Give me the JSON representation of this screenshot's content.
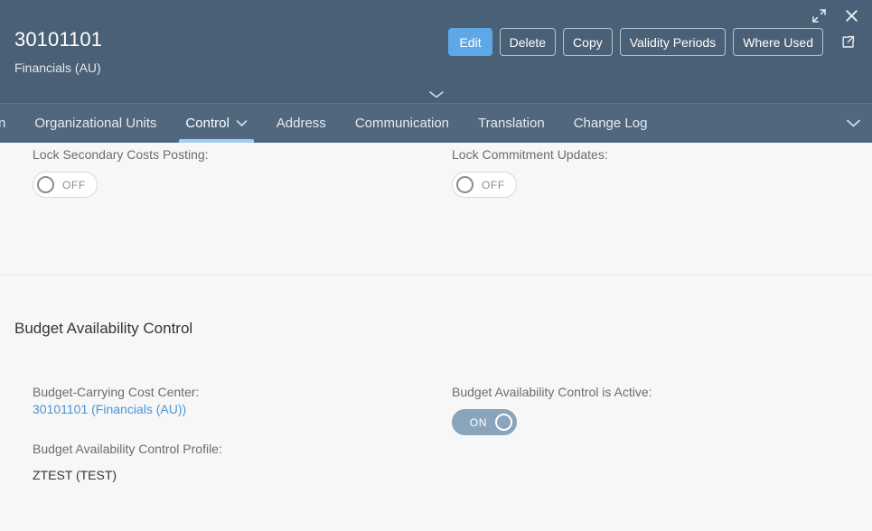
{
  "header": {
    "title": "30101101",
    "subtitle": "Financials (AU)",
    "actions": [
      {
        "label": "Edit",
        "type": "emphasized"
      },
      {
        "label": "Delete",
        "type": "transparent"
      },
      {
        "label": "Copy",
        "type": "transparent"
      },
      {
        "label": "Validity Periods",
        "type": "transparent"
      },
      {
        "label": "Where Used",
        "type": "transparent"
      }
    ],
    "icons": {
      "fullscreen": "enter-full-screen-icon",
      "close": "close-icon",
      "share": "share-icon",
      "collapse": "collapse-header-chevron-icon"
    },
    "colors": {
      "header_background": "#4a6076",
      "tabbar_background": "#50677d",
      "emphasized_button": "#5fa8e8",
      "selected_tab_underline": "#9fcdf2"
    }
  },
  "tabs": [
    {
      "label": "n",
      "selected": false,
      "truncated": true,
      "has_chevron": false
    },
    {
      "label": "Organizational Units",
      "selected": false,
      "has_chevron": false
    },
    {
      "label": "Control",
      "selected": true,
      "has_chevron": true
    },
    {
      "label": "Address",
      "selected": false,
      "has_chevron": false
    },
    {
      "label": "Communication",
      "selected": false,
      "has_chevron": false
    },
    {
      "label": "Translation",
      "selected": false,
      "has_chevron": false
    },
    {
      "label": "Change Log",
      "selected": false,
      "has_chevron": false
    }
  ],
  "tabbar_overflow_icon": "chevron-down-icon",
  "content": {
    "lock_section": {
      "secondary_costs": {
        "label": "Lock Secondary Costs Posting:",
        "switch_state": "OFF",
        "switch_on": false
      },
      "commitment_updates": {
        "label": "Lock Commitment Updates:",
        "switch_state": "OFF",
        "switch_on": false
      }
    },
    "budget_section": {
      "title": "Budget Availability Control",
      "cost_center": {
        "label": "Budget-Carrying Cost Center:",
        "link_text": "30101101 (Financials (AU))",
        "link_color": "#4a93d9"
      },
      "is_active": {
        "label": "Budget Availability Control is Active:",
        "switch_state": "ON",
        "switch_on": true
      },
      "profile": {
        "label": "Budget Availability Control Profile:",
        "value": "ZTEST (TEST)"
      }
    }
  }
}
